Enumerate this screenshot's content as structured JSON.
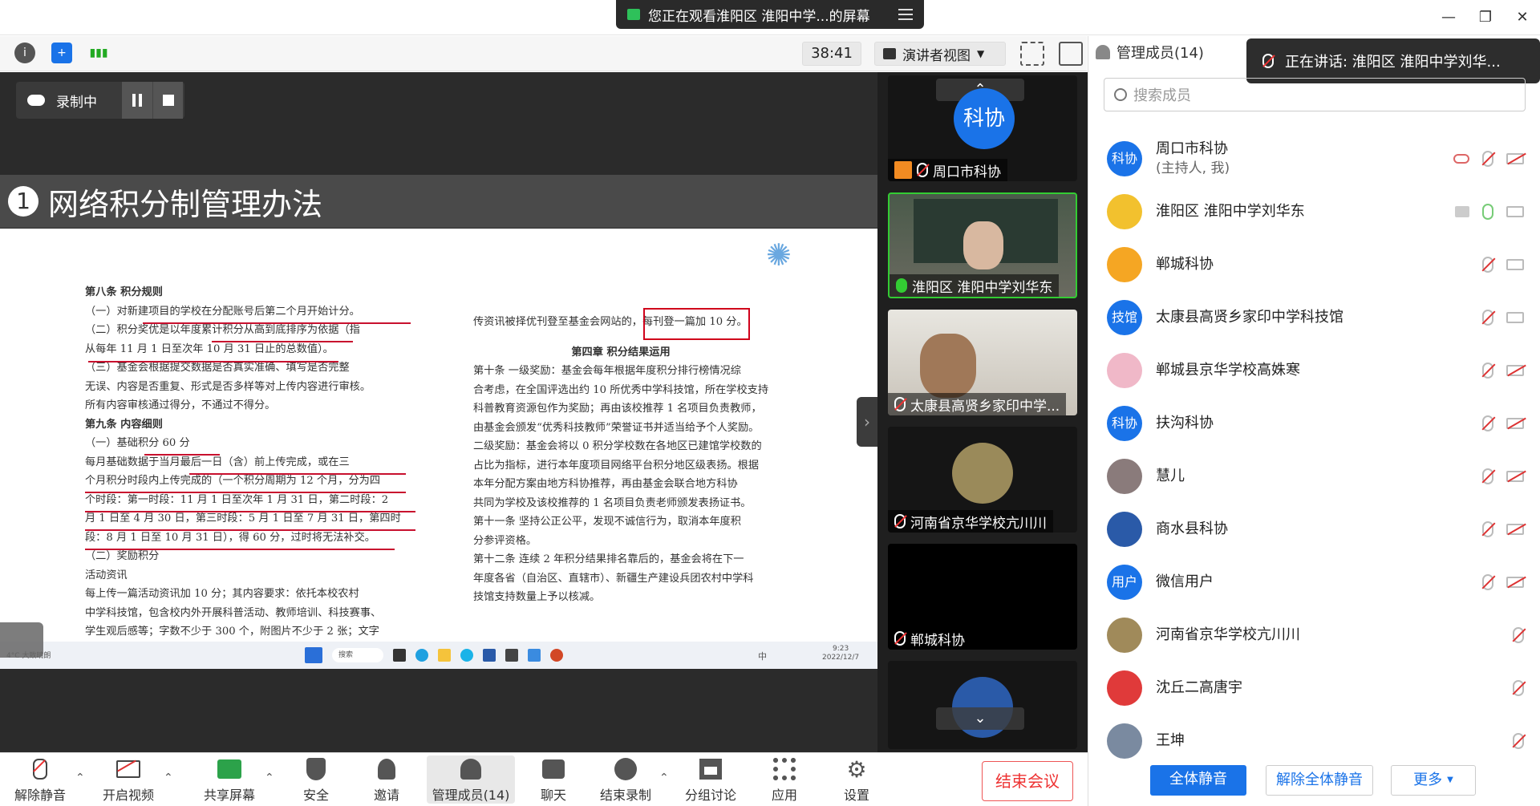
{
  "window": {
    "share_banner": "您正在观看淮阳区 淮阳中学...的屏幕",
    "minimize": "—",
    "restore": "❐",
    "close": "✕"
  },
  "toolbar": {
    "timer": "38:41",
    "view_label": "演讲者视图",
    "members_header": "管理成员(14)"
  },
  "recording": {
    "label": "录制中"
  },
  "slide": {
    "number": "1",
    "title": "网络积分制管理办法",
    "left_column": [
      {
        "text": "第八条  积分规则",
        "style": "hd"
      },
      {
        "text": "（一）对新建项目的学校在分配账号后第二个月开始计分。",
        "style": ""
      },
      {
        "text": "（二）积分奖优是以年度累计积分从高到底排序为依据（指",
        "style": ""
      },
      {
        "text": "从每年 11 月 1 日至次年 10 月 31 日止的总数值）。",
        "style": ""
      },
      {
        "text": "（三）基金会根据提交数据是否真实准确、填写是否完整",
        "style": ""
      },
      {
        "text": "无误、内容是否重复、形式是否多样等对上传内容进行审核。",
        "style": ""
      },
      {
        "text": "所有内容审核通过得分，不通过不得分。",
        "style": ""
      },
      {
        "text": "第九条  内容细则",
        "style": "hd"
      },
      {
        "text": "（一）基础积分 60 分",
        "style": ""
      },
      {
        "text": "每月基础数据于当月最后一日（含）前上传完成，或在三",
        "style": ""
      },
      {
        "text": "个月积分时段内上传完成的（一个积分周期为 12 个月，分为四",
        "style": ""
      },
      {
        "text": "个时段：第一时段：11 月 1 日至次年 1 月 31 日，第二时段：2",
        "style": ""
      },
      {
        "text": "月 1 日至 4 月 30 日，第三时段：5 月 1 日至 7 月 31 日，第四时",
        "style": ""
      },
      {
        "text": "段：8 月 1 日至 10 月 31 日），得 60 分，过时将无法补交。",
        "style": ""
      },
      {
        "text": "（二）奖励积分",
        "style": ""
      },
      {
        "text": "活动资讯",
        "style": ""
      },
      {
        "text": "每上传一篇活动资讯加 10 分；其内容要求：依托本校农村",
        "style": ""
      },
      {
        "text": "中学科技馆，包含校内外开展科普活动、教师培训、科技赛事、",
        "style": ""
      },
      {
        "text": "学生观后感等；字数不少于 300 个，附图片不少于 2 张；文字",
        "style": ""
      }
    ],
    "right_column": [
      {
        "text": "传资讯被择优刊登至基金会网站的，每刊登一篇加 10 分。",
        "style": ""
      },
      {
        "text": "",
        "style": ""
      },
      {
        "text": "第四章  积分结果运用",
        "style": "ctr"
      },
      {
        "text": "第十条  一级奖励：基金会每年根据年度积分排行榜情况综",
        "style": ""
      },
      {
        "text": "合考虑，在全国评选出约 10 所优秀中学科技馆，所在学校支持",
        "style": ""
      },
      {
        "text": "科普教育资源包作为奖励；再由该校推荐 1 名项目负责教师，",
        "style": ""
      },
      {
        "text": "由基金会颁发“优秀科技教师”荣誉证书并适当给予个人奖励。",
        "style": ""
      },
      {
        "text": "二级奖励：基金会将以 0 积分学校数在各地区已建馆学校数的",
        "style": ""
      },
      {
        "text": "占比为指标，进行本年度项目网络平台积分地区级表扬。根据",
        "style": ""
      },
      {
        "text": "本年分配方案由地方科协推荐，再由基金会联合地方科协",
        "style": ""
      },
      {
        "text": "共同为学校及该校推荐的 1 名项目负责老师颁发表扬证书。",
        "style": ""
      },
      {
        "text": "第十一条  坚持公正公平，发现不诚信行为，取消本年度积",
        "style": ""
      },
      {
        "text": "分参评资格。",
        "style": ""
      },
      {
        "text": "第十二条  连续 2 年积分结果排名靠后的，基金会将在下一",
        "style": ""
      },
      {
        "text": "年度各省（自治区、直辖市）、新疆生产建设兵团农村中学科",
        "style": ""
      },
      {
        "text": "技馆支持数量上予以核减。",
        "style": ""
      }
    ],
    "taskbar": {
      "weather": "4°C 大致晴朗",
      "search": "搜索",
      "ime": "中",
      "time": "9:23",
      "date": "2022/12/7"
    }
  },
  "video_tiles": [
    {
      "name": "周口市科协",
      "avatar": "科协",
      "mic": "off"
    },
    {
      "name": "淮阳区 淮阳中学刘华东",
      "mic": "on"
    },
    {
      "name": "太康县高贤乡家印中学...",
      "mic": "off"
    },
    {
      "name": "河南省京华学校亢川川",
      "mic": "off"
    },
    {
      "name": "郸城科协",
      "mic": "off"
    },
    {
      "name": "",
      "mic": "off"
    }
  ],
  "speaking": {
    "text": "正在讲话: 淮阳区 淮阳中学刘华..."
  },
  "member_search": {
    "placeholder": "搜索成员"
  },
  "members": [
    {
      "name": "周口市科协",
      "sub": "(主持人, 我)",
      "avatar": "科协",
      "color": "#1a73e8",
      "icons": [
        "cloud",
        "mic-off",
        "cam-off"
      ]
    },
    {
      "name": "淮阳区 淮阳中学刘华东",
      "sub": "",
      "avatar": "",
      "color": "#f2c12e",
      "icons": [
        "screen",
        "mic-on",
        "cam"
      ]
    },
    {
      "name": "郸城科协",
      "sub": "",
      "avatar": "",
      "color": "#f5a623",
      "icons": [
        "mic-off",
        "cam"
      ]
    },
    {
      "name": "太康县高贤乡家印中学科技馆",
      "sub": "",
      "avatar": "技馆",
      "color": "#1a73e8",
      "icons": [
        "mic-off",
        "cam"
      ]
    },
    {
      "name": "郸城县京华学校高姝寒",
      "sub": "",
      "avatar": "",
      "color": "#f0b8c8",
      "icons": [
        "mic-off",
        "cam-off"
      ]
    },
    {
      "name": "扶沟科协",
      "sub": "",
      "avatar": "科协",
      "color": "#1a73e8",
      "icons": [
        "mic-off",
        "cam-off"
      ]
    },
    {
      "name": "慧儿",
      "sub": "",
      "avatar": "",
      "color": "#8a7b7b",
      "icons": [
        "mic-off",
        "cam-off"
      ]
    },
    {
      "name": "商水县科协",
      "sub": "",
      "avatar": "",
      "color": "#2a5aa8",
      "icons": [
        "mic-off",
        "cam-off"
      ]
    },
    {
      "name": "微信用户",
      "sub": "",
      "avatar": "用户",
      "color": "#1a73e8",
      "icons": [
        "mic-off",
        "cam-off"
      ]
    },
    {
      "name": "河南省京华学校亢川川",
      "sub": "",
      "avatar": "",
      "color": "#a08a5a",
      "icons": [
        "mic-off"
      ]
    },
    {
      "name": "沈丘二高唐宇",
      "sub": "",
      "avatar": "",
      "color": "#e03a3a",
      "icons": [
        "mic-off"
      ]
    },
    {
      "name": "王坤",
      "sub": "",
      "avatar": "",
      "color": "#7a8aa0",
      "icons": [
        "mic-off"
      ]
    }
  ],
  "bottom_toolbar": {
    "unmute": "解除静音",
    "video": "开启视频",
    "share": "共享屏幕",
    "security": "安全",
    "invite": "邀请",
    "members": "管理成员(14)",
    "chat": "聊天",
    "stop_record": "结束录制",
    "breakout": "分组讨论",
    "apps": "应用",
    "settings": "设置",
    "end_meeting": "结束会议"
  },
  "panel_buttons": {
    "mute_all": "全体静音",
    "unmute_all": "解除全体静音",
    "more": "更多"
  },
  "colors": {
    "accent": "#1a73e8",
    "danger": "#e53935",
    "stage_bg": "#2b2b2b"
  }
}
